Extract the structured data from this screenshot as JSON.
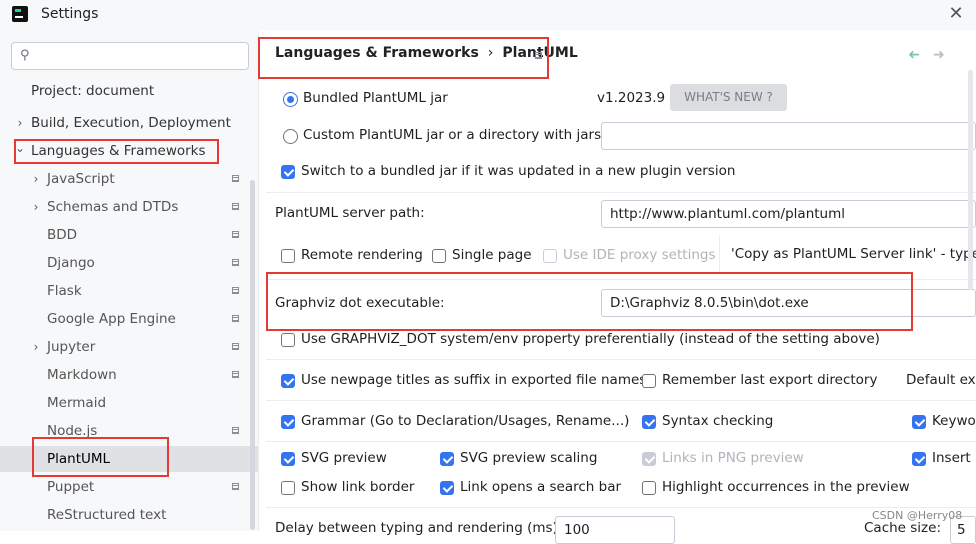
{
  "window": {
    "title": "Settings",
    "close_symbol": "✕"
  },
  "search": {
    "placeholder": "",
    "icon_glyph": "⚲"
  },
  "sidebar": {
    "project": "Project: document",
    "items": [
      {
        "label": "Build, Execution, Deployment",
        "chevron": "›"
      },
      {
        "label": "Languages & Frameworks",
        "chevron": "⌄"
      },
      {
        "label": "JavaScript",
        "chevron": "›"
      },
      {
        "label": "Schemas and DTDs",
        "chevron": "›"
      },
      {
        "label": "BDD"
      },
      {
        "label": "Django"
      },
      {
        "label": "Flask"
      },
      {
        "label": "Google App Engine"
      },
      {
        "label": "Jupyter",
        "chevron": "›"
      },
      {
        "label": "Markdown"
      },
      {
        "label": "Mermaid"
      },
      {
        "label": "Node.js"
      },
      {
        "label": "PlantUML"
      },
      {
        "label": "Puppet"
      },
      {
        "label": "ReStructured text"
      }
    ]
  },
  "breadcrumb": {
    "parent": "Languages & Frameworks",
    "separator": "›",
    "current": "PlantUML"
  },
  "nav": {
    "back": "➜",
    "forward": "➜"
  },
  "plantuml": {
    "bundled_label": "Bundled PlantUML jar",
    "version": "v1.2023.9",
    "whats_new": "WHAT'S NEW ?",
    "custom_label": "Custom PlantUML jar or a directory with jars:",
    "custom_value": "",
    "switch_bundled": "Switch to a bundled jar if it was updated in a new plugin version",
    "server_path_label": "PlantUML server path:",
    "server_path_value": "http://www.plantuml.com/plantuml",
    "remote_rendering": "Remote rendering",
    "single_page": "Single page",
    "use_ide_proxy": "Use IDE proxy settings",
    "copy_link_type": "'Copy as PlantUML Server link' - type:",
    "graphviz_label": "Graphviz dot executable:",
    "graphviz_value": "D:\\Graphviz 8.0.5\\bin\\dot.exe",
    "use_graphviz_env": "Use GRAPHVIZ_DOT system/env property preferentially (instead of the setting above)",
    "newpage_titles": "Use newpage titles as suffix in exported file names",
    "remember_export": "Remember last export directory",
    "default_export": "Default exp",
    "grammar": "Grammar (Go to Declaration/Usages, Rename...)",
    "syntax_checking": "Syntax checking",
    "keyword": "Keywor",
    "svg_preview": "SVG preview",
    "svg_scaling": "SVG preview scaling",
    "links_png": "Links in PNG preview",
    "insert": "Insert p",
    "show_link_border": "Show link border",
    "link_search": "Link opens a search bar",
    "highlight_occ": "Highlight occurrences in the preview",
    "delay_label": "Delay between typing and rendering (ms):",
    "delay_value": "100",
    "cache_label": "Cache size:",
    "cache_value": "5"
  },
  "watermark": "CSDN @Herry08",
  "colors": {
    "accent": "#3574f0",
    "highlight_box": "#e53935",
    "selected_row": "#dfe1e5"
  }
}
